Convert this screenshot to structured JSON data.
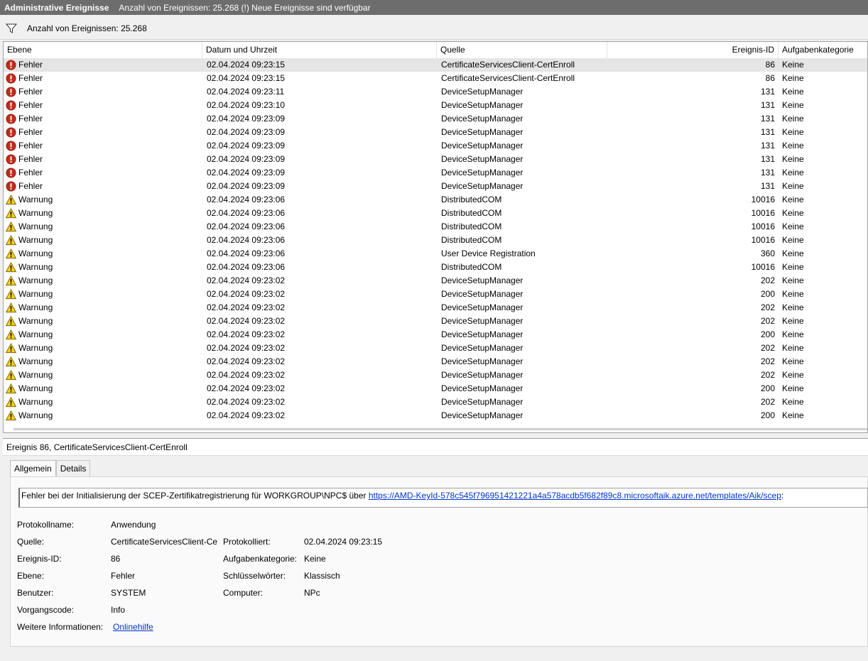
{
  "title": {
    "name": "Administrative Ereignisse",
    "info": "Anzahl von Ereignissen: 25.268 (!) Neue Ereignisse sind verfügbar"
  },
  "filter": {
    "icon": "filter-icon",
    "text": "Anzahl von Ereignissen: 25.268"
  },
  "columns": [
    "Ebene",
    "Datum und Uhrzeit",
    "Quelle",
    "Ereignis-ID",
    "Aufgabenkategorie"
  ],
  "rows": [
    {
      "level": "Fehler",
      "date": "02.04.2024 09:23:15",
      "source": "CertificateServicesClient-CertEnroll",
      "id": "86",
      "category": "Keine"
    },
    {
      "level": "Fehler",
      "date": "02.04.2024 09:23:15",
      "source": "CertificateServicesClient-CertEnroll",
      "id": "86",
      "category": "Keine"
    },
    {
      "level": "Fehler",
      "date": "02.04.2024 09:23:11",
      "source": "DeviceSetupManager",
      "id": "131",
      "category": "Keine"
    },
    {
      "level": "Fehler",
      "date": "02.04.2024 09:23:10",
      "source": "DeviceSetupManager",
      "id": "131",
      "category": "Keine"
    },
    {
      "level": "Fehler",
      "date": "02.04.2024 09:23:09",
      "source": "DeviceSetupManager",
      "id": "131",
      "category": "Keine"
    },
    {
      "level": "Fehler",
      "date": "02.04.2024 09:23:09",
      "source": "DeviceSetupManager",
      "id": "131",
      "category": "Keine"
    },
    {
      "level": "Fehler",
      "date": "02.04.2024 09:23:09",
      "source": "DeviceSetupManager",
      "id": "131",
      "category": "Keine"
    },
    {
      "level": "Fehler",
      "date": "02.04.2024 09:23:09",
      "source": "DeviceSetupManager",
      "id": "131",
      "category": "Keine"
    },
    {
      "level": "Fehler",
      "date": "02.04.2024 09:23:09",
      "source": "DeviceSetupManager",
      "id": "131",
      "category": "Keine"
    },
    {
      "level": "Fehler",
      "date": "02.04.2024 09:23:09",
      "source": "DeviceSetupManager",
      "id": "131",
      "category": "Keine"
    },
    {
      "level": "Warnung",
      "date": "02.04.2024 09:23:06",
      "source": "DistributedCOM",
      "id": "10016",
      "category": "Keine"
    },
    {
      "level": "Warnung",
      "date": "02.04.2024 09:23:06",
      "source": "DistributedCOM",
      "id": "10016",
      "category": "Keine"
    },
    {
      "level": "Warnung",
      "date": "02.04.2024 09:23:06",
      "source": "DistributedCOM",
      "id": "10016",
      "category": "Keine"
    },
    {
      "level": "Warnung",
      "date": "02.04.2024 09:23:06",
      "source": "DistributedCOM",
      "id": "10016",
      "category": "Keine"
    },
    {
      "level": "Warnung",
      "date": "02.04.2024 09:23:06",
      "source": "User Device Registration",
      "id": "360",
      "category": "Keine"
    },
    {
      "level": "Warnung",
      "date": "02.04.2024 09:23:06",
      "source": "DistributedCOM",
      "id": "10016",
      "category": "Keine"
    },
    {
      "level": "Warnung",
      "date": "02.04.2024 09:23:02",
      "source": "DeviceSetupManager",
      "id": "202",
      "category": "Keine"
    },
    {
      "level": "Warnung",
      "date": "02.04.2024 09:23:02",
      "source": "DeviceSetupManager",
      "id": "200",
      "category": "Keine"
    },
    {
      "level": "Warnung",
      "date": "02.04.2024 09:23:02",
      "source": "DeviceSetupManager",
      "id": "202",
      "category": "Keine"
    },
    {
      "level": "Warnung",
      "date": "02.04.2024 09:23:02",
      "source": "DeviceSetupManager",
      "id": "202",
      "category": "Keine"
    },
    {
      "level": "Warnung",
      "date": "02.04.2024 09:23:02",
      "source": "DeviceSetupManager",
      "id": "200",
      "category": "Keine"
    },
    {
      "level": "Warnung",
      "date": "02.04.2024 09:23:02",
      "source": "DeviceSetupManager",
      "id": "202",
      "category": "Keine"
    },
    {
      "level": "Warnung",
      "date": "02.04.2024 09:23:02",
      "source": "DeviceSetupManager",
      "id": "202",
      "category": "Keine"
    },
    {
      "level": "Warnung",
      "date": "02.04.2024 09:23:02",
      "source": "DeviceSetupManager",
      "id": "202",
      "category": "Keine"
    },
    {
      "level": "Warnung",
      "date": "02.04.2024 09:23:02",
      "source": "DeviceSetupManager",
      "id": "200",
      "category": "Keine"
    },
    {
      "level": "Warnung",
      "date": "02.04.2024 09:23:02",
      "source": "DeviceSetupManager",
      "id": "202",
      "category": "Keine"
    },
    {
      "level": "Warnung",
      "date": "02.04.2024 09:23:02",
      "source": "DeviceSetupManager",
      "id": "200",
      "category": "Keine"
    }
  ],
  "detail": {
    "header": "Ereignis 86, CertificateServicesClient-CertEnroll",
    "tabs": [
      "Allgemein",
      "Details"
    ],
    "message_prefix": "Fehler bei der Initialisierung der SCEP-Zertifikatregistrierung für WORKGROUP\\NPC$ über ",
    "message_link": "https://AMD-KeyId-578c545f796951421221a4a578acdb5f682f89c8.microsoftaik.azure.net/templates/Aik/scep",
    "message_suffix": ":",
    "labels": {
      "log_name": "Protokollname:",
      "source": "Quelle:",
      "event_id": "Ereignis-ID:",
      "level": "Ebene:",
      "user": "Benutzer:",
      "opcode": "Vorgangscode:",
      "more_info": "Weitere Informationen:",
      "logged": "Protokolliert:",
      "task_category": "Aufgabenkategorie:",
      "keywords": "Schlüsselwörter:",
      "computer": "Computer:"
    },
    "values": {
      "log_name": "Anwendung",
      "source": "CertificateServicesClient-CertEnroll",
      "event_id": "86",
      "level": "Fehler",
      "user": "SYSTEM",
      "opcode": "Info",
      "more_info": "Onlinehilfe",
      "logged": "02.04.2024 09:23:15",
      "task_category": "Keine",
      "keywords": "Klassisch",
      "computer": "NPc"
    }
  },
  "colors": {
    "titlebar": "#6d6d6d",
    "error": "#c42b1c",
    "warning": "#f7d224",
    "link": "#0033cc",
    "selected_row": "#e5e5e5"
  }
}
